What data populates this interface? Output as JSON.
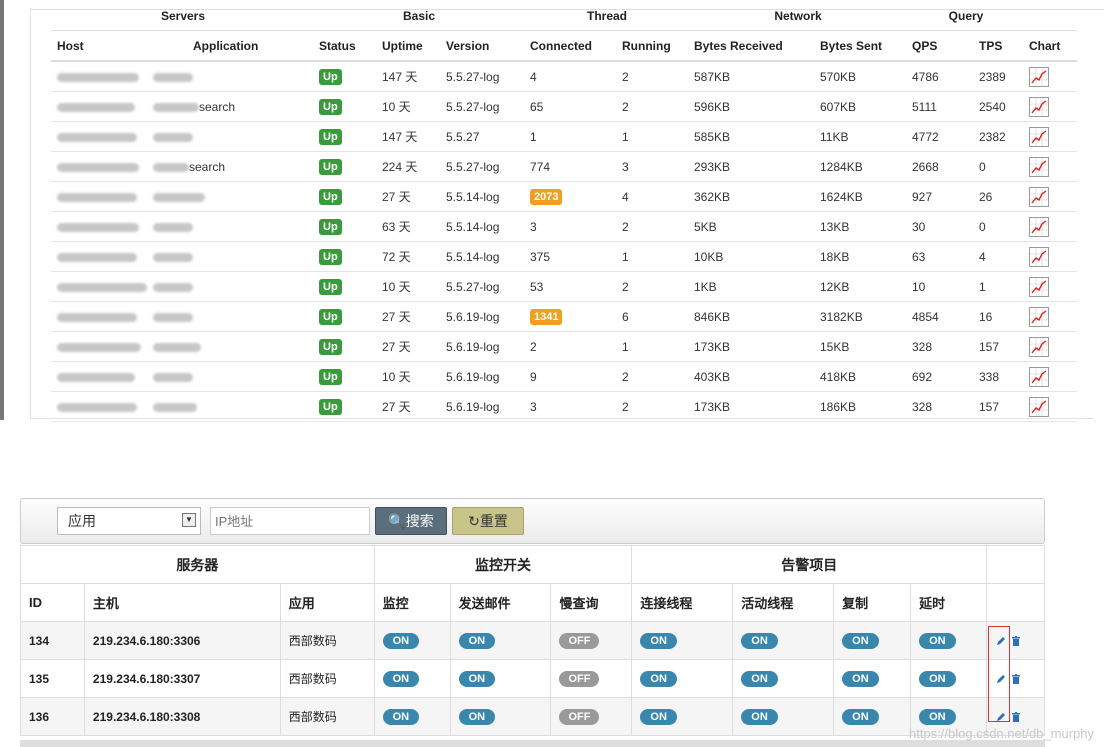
{
  "top_table": {
    "groups": [
      "Servers",
      "Basic",
      "Thread",
      "Network",
      "Query"
    ],
    "columns": [
      "Host",
      "Application",
      "Status",
      "Uptime",
      "Version",
      "Connected",
      "Running",
      "Bytes Received",
      "Bytes Sent",
      "QPS",
      "TPS",
      "Chart"
    ],
    "rows": [
      {
        "host_tail": "",
        "app_tail": "",
        "status": "Up",
        "uptime": "147 天",
        "version": "5.5.27-log",
        "connected": "4",
        "connected_warn": false,
        "running": "2",
        "recv": "587KB",
        "sent": "570KB",
        "qps": "4786",
        "tps": "2389"
      },
      {
        "host_tail": "",
        "app_tail": "search",
        "status": "Up",
        "uptime": "10 天",
        "version": "5.5.27-log",
        "connected": "65",
        "connected_warn": false,
        "running": "2",
        "recv": "596KB",
        "sent": "607KB",
        "qps": "5111",
        "tps": "2540"
      },
      {
        "host_tail": "",
        "app_tail": "",
        "status": "Up",
        "uptime": "147 天",
        "version": "5.5.27",
        "connected": "1",
        "connected_warn": false,
        "running": "1",
        "recv": "585KB",
        "sent": "11KB",
        "qps": "4772",
        "tps": "2382"
      },
      {
        "host_tail": "",
        "app_tail": "search",
        "status": "Up",
        "uptime": "224 天",
        "version": "5.5.27-log",
        "connected": "774",
        "connected_warn": false,
        "running": "3",
        "recv": "293KB",
        "sent": "1284KB",
        "qps": "2668",
        "tps": "0"
      },
      {
        "host_tail": "",
        "app_tail": "",
        "status": "Up",
        "uptime": "27 天",
        "version": "5.5.14-log",
        "connected": "2073",
        "connected_warn": true,
        "running": "4",
        "recv": "362KB",
        "sent": "1624KB",
        "qps": "927",
        "tps": "26"
      },
      {
        "host_tail": "",
        "app_tail": "",
        "status": "Up",
        "uptime": "63 天",
        "version": "5.5.14-log",
        "connected": "3",
        "connected_warn": false,
        "running": "2",
        "recv": "5KB",
        "sent": "13KB",
        "qps": "30",
        "tps": "0"
      },
      {
        "host_tail": "",
        "app_tail": "",
        "status": "Up",
        "uptime": "72 天",
        "version": "5.5.14-log",
        "connected": "375",
        "connected_warn": false,
        "running": "1",
        "recv": "10KB",
        "sent": "18KB",
        "qps": "63",
        "tps": "4"
      },
      {
        "host_tail": "",
        "app_tail": "",
        "status": "Up",
        "uptime": "10 天",
        "version": "5.5.27-log",
        "connected": "53",
        "connected_warn": false,
        "running": "2",
        "recv": "1KB",
        "sent": "12KB",
        "qps": "10",
        "tps": "1"
      },
      {
        "host_tail": "",
        "app_tail": "",
        "status": "Up",
        "uptime": "27 天",
        "version": "5.6.19-log",
        "connected": "1341",
        "connected_warn": true,
        "running": "6",
        "recv": "846KB",
        "sent": "3182KB",
        "qps": "4854",
        "tps": "16"
      },
      {
        "host_tail": "",
        "app_tail": "",
        "status": "Up",
        "uptime": "27 天",
        "version": "5.6.19-log",
        "connected": "2",
        "connected_warn": false,
        "running": "1",
        "recv": "173KB",
        "sent": "15KB",
        "qps": "328",
        "tps": "157"
      },
      {
        "host_tail": "",
        "app_tail": "",
        "status": "Up",
        "uptime": "10 天",
        "version": "5.6.19-log",
        "connected": "9",
        "connected_warn": false,
        "running": "2",
        "recv": "403KB",
        "sent": "418KB",
        "qps": "692",
        "tps": "338"
      },
      {
        "host_tail": "",
        "app_tail": "",
        "status": "Up",
        "uptime": "27 天",
        "version": "5.6.19-log",
        "connected": "3",
        "connected_warn": false,
        "running": "2",
        "recv": "173KB",
        "sent": "186KB",
        "qps": "328",
        "tps": "157"
      }
    ]
  },
  "filter": {
    "select_value": "应用",
    "ip_placeholder": "IP地址",
    "search_label": "搜索",
    "reset_label": "重置"
  },
  "bottom_table": {
    "groups": {
      "servers": "服务器",
      "switches": "监控开关",
      "alerts": "告警项目"
    },
    "columns": [
      "ID",
      "主机",
      "应用",
      "监控",
      "发送邮件",
      "慢查询",
      "连接线程",
      "活动线程",
      "复制",
      "延时"
    ],
    "rows": [
      {
        "id": "134",
        "host": "219.234.6.180:3306",
        "app": "西部数码",
        "monitor": "ON",
        "mail": "ON",
        "slow": "OFF",
        "conn": "ON",
        "active": "ON",
        "repl": "ON",
        "delay": "ON"
      },
      {
        "id": "135",
        "host": "219.234.6.180:3307",
        "app": "西部数码",
        "monitor": "ON",
        "mail": "ON",
        "slow": "OFF",
        "conn": "ON",
        "active": "ON",
        "repl": "ON",
        "delay": "ON"
      },
      {
        "id": "136",
        "host": "219.234.6.180:3308",
        "app": "西部数码",
        "monitor": "ON",
        "mail": "ON",
        "slow": "OFF",
        "conn": "ON",
        "active": "ON",
        "repl": "ON",
        "delay": "ON"
      }
    ]
  },
  "watermark": "https://blog.csdn.net/db_murphy",
  "colors": {
    "up": "#3a9b3c",
    "warn": "#f0a020",
    "on": "#3a87ad",
    "off": "#999999",
    "search_btn": "#5a6f7b",
    "reset_btn": "#c9c48a"
  }
}
